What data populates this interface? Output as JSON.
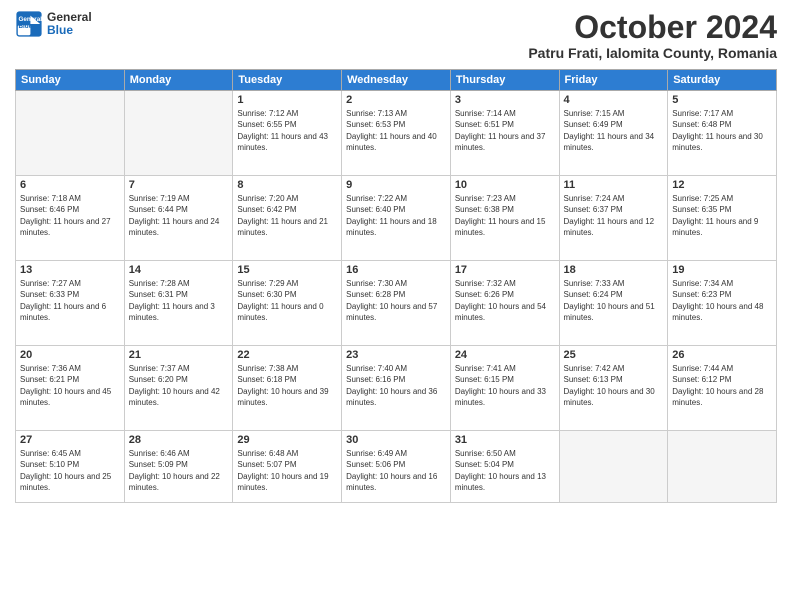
{
  "header": {
    "logo_line1": "General",
    "logo_line2": "Blue",
    "month_title": "October 2024",
    "location": "Patru Frati, Ialomita County, Romania"
  },
  "weekdays": [
    "Sunday",
    "Monday",
    "Tuesday",
    "Wednesday",
    "Thursday",
    "Friday",
    "Saturday"
  ],
  "weeks": [
    [
      {
        "day": "",
        "sunrise": "",
        "sunset": "",
        "daylight": ""
      },
      {
        "day": "",
        "sunrise": "",
        "sunset": "",
        "daylight": ""
      },
      {
        "day": "1",
        "sunrise": "Sunrise: 7:12 AM",
        "sunset": "Sunset: 6:55 PM",
        "daylight": "Daylight: 11 hours and 43 minutes."
      },
      {
        "day": "2",
        "sunrise": "Sunrise: 7:13 AM",
        "sunset": "Sunset: 6:53 PM",
        "daylight": "Daylight: 11 hours and 40 minutes."
      },
      {
        "day": "3",
        "sunrise": "Sunrise: 7:14 AM",
        "sunset": "Sunset: 6:51 PM",
        "daylight": "Daylight: 11 hours and 37 minutes."
      },
      {
        "day": "4",
        "sunrise": "Sunrise: 7:15 AM",
        "sunset": "Sunset: 6:49 PM",
        "daylight": "Daylight: 11 hours and 34 minutes."
      },
      {
        "day": "5",
        "sunrise": "Sunrise: 7:17 AM",
        "sunset": "Sunset: 6:48 PM",
        "daylight": "Daylight: 11 hours and 30 minutes."
      }
    ],
    [
      {
        "day": "6",
        "sunrise": "Sunrise: 7:18 AM",
        "sunset": "Sunset: 6:46 PM",
        "daylight": "Daylight: 11 hours and 27 minutes."
      },
      {
        "day": "7",
        "sunrise": "Sunrise: 7:19 AM",
        "sunset": "Sunset: 6:44 PM",
        "daylight": "Daylight: 11 hours and 24 minutes."
      },
      {
        "day": "8",
        "sunrise": "Sunrise: 7:20 AM",
        "sunset": "Sunset: 6:42 PM",
        "daylight": "Daylight: 11 hours and 21 minutes."
      },
      {
        "day": "9",
        "sunrise": "Sunrise: 7:22 AM",
        "sunset": "Sunset: 6:40 PM",
        "daylight": "Daylight: 11 hours and 18 minutes."
      },
      {
        "day": "10",
        "sunrise": "Sunrise: 7:23 AM",
        "sunset": "Sunset: 6:38 PM",
        "daylight": "Daylight: 11 hours and 15 minutes."
      },
      {
        "day": "11",
        "sunrise": "Sunrise: 7:24 AM",
        "sunset": "Sunset: 6:37 PM",
        "daylight": "Daylight: 11 hours and 12 minutes."
      },
      {
        "day": "12",
        "sunrise": "Sunrise: 7:25 AM",
        "sunset": "Sunset: 6:35 PM",
        "daylight": "Daylight: 11 hours and 9 minutes."
      }
    ],
    [
      {
        "day": "13",
        "sunrise": "Sunrise: 7:27 AM",
        "sunset": "Sunset: 6:33 PM",
        "daylight": "Daylight: 11 hours and 6 minutes."
      },
      {
        "day": "14",
        "sunrise": "Sunrise: 7:28 AM",
        "sunset": "Sunset: 6:31 PM",
        "daylight": "Daylight: 11 hours and 3 minutes."
      },
      {
        "day": "15",
        "sunrise": "Sunrise: 7:29 AM",
        "sunset": "Sunset: 6:30 PM",
        "daylight": "Daylight: 11 hours and 0 minutes."
      },
      {
        "day": "16",
        "sunrise": "Sunrise: 7:30 AM",
        "sunset": "Sunset: 6:28 PM",
        "daylight": "Daylight: 10 hours and 57 minutes."
      },
      {
        "day": "17",
        "sunrise": "Sunrise: 7:32 AM",
        "sunset": "Sunset: 6:26 PM",
        "daylight": "Daylight: 10 hours and 54 minutes."
      },
      {
        "day": "18",
        "sunrise": "Sunrise: 7:33 AM",
        "sunset": "Sunset: 6:24 PM",
        "daylight": "Daylight: 10 hours and 51 minutes."
      },
      {
        "day": "19",
        "sunrise": "Sunrise: 7:34 AM",
        "sunset": "Sunset: 6:23 PM",
        "daylight": "Daylight: 10 hours and 48 minutes."
      }
    ],
    [
      {
        "day": "20",
        "sunrise": "Sunrise: 7:36 AM",
        "sunset": "Sunset: 6:21 PM",
        "daylight": "Daylight: 10 hours and 45 minutes."
      },
      {
        "day": "21",
        "sunrise": "Sunrise: 7:37 AM",
        "sunset": "Sunset: 6:20 PM",
        "daylight": "Daylight: 10 hours and 42 minutes."
      },
      {
        "day": "22",
        "sunrise": "Sunrise: 7:38 AM",
        "sunset": "Sunset: 6:18 PM",
        "daylight": "Daylight: 10 hours and 39 minutes."
      },
      {
        "day": "23",
        "sunrise": "Sunrise: 7:40 AM",
        "sunset": "Sunset: 6:16 PM",
        "daylight": "Daylight: 10 hours and 36 minutes."
      },
      {
        "day": "24",
        "sunrise": "Sunrise: 7:41 AM",
        "sunset": "Sunset: 6:15 PM",
        "daylight": "Daylight: 10 hours and 33 minutes."
      },
      {
        "day": "25",
        "sunrise": "Sunrise: 7:42 AM",
        "sunset": "Sunset: 6:13 PM",
        "daylight": "Daylight: 10 hours and 30 minutes."
      },
      {
        "day": "26",
        "sunrise": "Sunrise: 7:44 AM",
        "sunset": "Sunset: 6:12 PM",
        "daylight": "Daylight: 10 hours and 28 minutes."
      }
    ],
    [
      {
        "day": "27",
        "sunrise": "Sunrise: 6:45 AM",
        "sunset": "Sunset: 5:10 PM",
        "daylight": "Daylight: 10 hours and 25 minutes."
      },
      {
        "day": "28",
        "sunrise": "Sunrise: 6:46 AM",
        "sunset": "Sunset: 5:09 PM",
        "daylight": "Daylight: 10 hours and 22 minutes."
      },
      {
        "day": "29",
        "sunrise": "Sunrise: 6:48 AM",
        "sunset": "Sunset: 5:07 PM",
        "daylight": "Daylight: 10 hours and 19 minutes."
      },
      {
        "day": "30",
        "sunrise": "Sunrise: 6:49 AM",
        "sunset": "Sunset: 5:06 PM",
        "daylight": "Daylight: 10 hours and 16 minutes."
      },
      {
        "day": "31",
        "sunrise": "Sunrise: 6:50 AM",
        "sunset": "Sunset: 5:04 PM",
        "daylight": "Daylight: 10 hours and 13 minutes."
      },
      {
        "day": "",
        "sunrise": "",
        "sunset": "",
        "daylight": ""
      },
      {
        "day": "",
        "sunrise": "",
        "sunset": "",
        "daylight": ""
      }
    ]
  ]
}
